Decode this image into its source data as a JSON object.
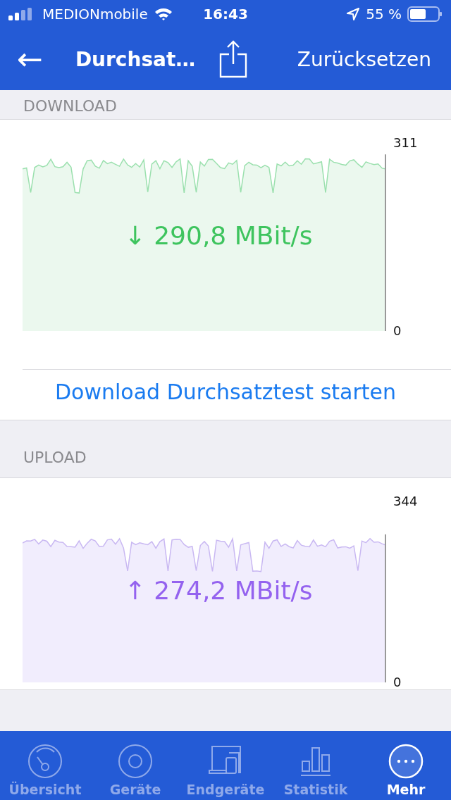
{
  "status_bar": {
    "carrier": "MEDIONmobile",
    "time": "16:43",
    "battery": "55 %"
  },
  "nav_bar": {
    "back": "←",
    "title": "Durchsat…",
    "action": "Zurücksetzen"
  },
  "sections": [
    {
      "header": "DOWNLOAD",
      "kind": "download",
      "reading": "290,8 MBit/s",
      "arrow": "↓",
      "axis_max": "311",
      "axis_min": "0",
      "button": "Download Durchsatztest starten"
    },
    {
      "header": "UPLOAD",
      "kind": "upload",
      "reading": "274,2 MBit/s",
      "arrow": "↑",
      "axis_max": "344",
      "axis_min": "0"
    }
  ],
  "tab_bar": [
    {
      "label": "Übersicht",
      "kind": "gauge",
      "selected": false
    },
    {
      "label": "Geräte",
      "kind": "disc",
      "selected": false
    },
    {
      "label": "Endgeräte",
      "kind": "devices",
      "selected": false
    },
    {
      "label": "Statistik",
      "kind": "bars",
      "selected": false
    },
    {
      "label": "Mehr",
      "kind": "more",
      "selected": true
    }
  ]
}
